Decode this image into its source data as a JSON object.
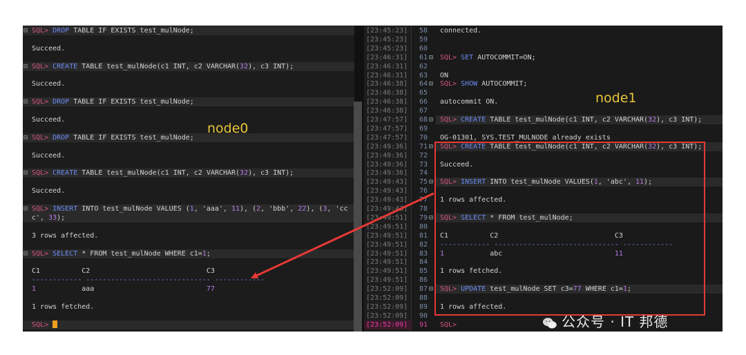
{
  "left": {
    "label": "node0",
    "lines": [
      {
        "fold": "⊟",
        "parts": [
          [
            "pr",
            "SQL> "
          ],
          [
            "kw",
            "DROP"
          ],
          [
            "txt",
            " TABLE IF EXISTS test_mulNode;"
          ]
        ],
        "hl": true
      },
      {
        "parts": [
          [
            "txt",
            ""
          ]
        ]
      },
      {
        "parts": [
          [
            "txt",
            "Succeed."
          ]
        ]
      },
      {
        "parts": [
          [
            "txt",
            ""
          ]
        ]
      },
      {
        "fold": "⊟",
        "parts": [
          [
            "pr",
            "SQL> "
          ],
          [
            "kw",
            "CREATE"
          ],
          [
            "txt",
            " TABLE test_mulNode(c1 INT, c2 VARCHAR("
          ],
          [
            "num",
            "32"
          ],
          [
            "txt",
            "), c3 INT);"
          ]
        ],
        "hl": true
      },
      {
        "parts": [
          [
            "txt",
            ""
          ]
        ]
      },
      {
        "parts": [
          [
            "txt",
            "Succeed."
          ]
        ]
      },
      {
        "parts": [
          [
            "txt",
            ""
          ]
        ]
      },
      {
        "fold": "⊟",
        "parts": [
          [
            "pr",
            "SQL> "
          ],
          [
            "kw",
            "DROP"
          ],
          [
            "txt",
            " TABLE IF EXISTS test_mulNode;"
          ]
        ],
        "hl": true
      },
      {
        "parts": [
          [
            "txt",
            ""
          ]
        ]
      },
      {
        "parts": [
          [
            "txt",
            "Succeed."
          ]
        ]
      },
      {
        "parts": [
          [
            "txt",
            ""
          ]
        ]
      },
      {
        "fold": "⊟",
        "parts": [
          [
            "pr",
            "SQL> "
          ],
          [
            "kw",
            "DROP"
          ],
          [
            "txt",
            " TABLE IF EXISTS test_mulNode;"
          ]
        ],
        "hl": true
      },
      {
        "parts": [
          [
            "txt",
            ""
          ]
        ]
      },
      {
        "parts": [
          [
            "txt",
            "Succeed."
          ]
        ]
      },
      {
        "parts": [
          [
            "txt",
            ""
          ]
        ]
      },
      {
        "fold": "⊟",
        "parts": [
          [
            "pr",
            "SQL> "
          ],
          [
            "kw",
            "CREATE"
          ],
          [
            "txt",
            " TABLE test_mulNode(c1 INT, c2 VARCHAR("
          ],
          [
            "num",
            "32"
          ],
          [
            "txt",
            "), c3 INT);"
          ]
        ],
        "hl": true
      },
      {
        "parts": [
          [
            "txt",
            ""
          ]
        ]
      },
      {
        "parts": [
          [
            "txt",
            "Succeed."
          ]
        ]
      },
      {
        "parts": [
          [
            "txt",
            ""
          ]
        ]
      },
      {
        "fold": "⊟",
        "parts": [
          [
            "pr",
            "SQL> "
          ],
          [
            "kw",
            "INSERT"
          ],
          [
            "txt",
            " INTO test_mulNode VALUES ("
          ],
          [
            "num",
            "1"
          ],
          [
            "txt",
            ", 'aaa', "
          ],
          [
            "num",
            "11"
          ],
          [
            "txt",
            "), ("
          ],
          [
            "num",
            "2"
          ],
          [
            "txt",
            ", 'bbb', "
          ],
          [
            "num",
            "22"
          ],
          [
            "txt",
            "), ("
          ],
          [
            "num",
            "3"
          ],
          [
            "txt",
            ", 'cc"
          ]
        ],
        "hl": true
      },
      {
        "parts": [
          [
            "txt",
            "c', "
          ],
          [
            "num",
            "33"
          ],
          [
            "txt",
            ");"
          ]
        ],
        "hl": true
      },
      {
        "parts": [
          [
            "txt",
            ""
          ]
        ]
      },
      {
        "parts": [
          [
            "txt",
            "3 rows affected."
          ]
        ]
      },
      {
        "parts": [
          [
            "txt",
            ""
          ]
        ]
      },
      {
        "fold": "⊟",
        "parts": [
          [
            "pr",
            "SQL> "
          ],
          [
            "kw",
            "SELECT"
          ],
          [
            "txt",
            " * FROM test_mulNode WHERE c1="
          ],
          [
            "num",
            "1"
          ],
          [
            "txt",
            ";"
          ]
        ],
        "hl": true
      },
      {
        "parts": [
          [
            "txt",
            ""
          ]
        ]
      },
      {
        "parts": [
          [
            "txt",
            "C1          C2                            C3"
          ]
        ]
      },
      {
        "parts": [
          [
            "kw",
            "------------ ------------------------------ ------------"
          ]
        ]
      },
      {
        "parts": [
          [
            "num",
            "1"
          ],
          [
            "txt",
            "           aaa                           "
          ],
          [
            "num",
            "77"
          ]
        ]
      },
      {
        "parts": [
          [
            "txt",
            ""
          ]
        ]
      },
      {
        "parts": [
          [
            "txt",
            "1 rows fetched."
          ]
        ]
      },
      {
        "parts": [
          [
            "txt",
            ""
          ]
        ]
      },
      {
        "parts": [
          [
            "pr",
            "SQL> "
          ]
        ],
        "cursor": true,
        "hl": true
      }
    ]
  },
  "right": {
    "label": "node1",
    "lines": [
      {
        "ts": "[23:45:23]",
        "ln": "58",
        "parts": [
          [
            "txt",
            "connected."
          ]
        ]
      },
      {
        "ts": "[23:45:23]",
        "ln": "59",
        "parts": [
          [
            "txt",
            ""
          ]
        ]
      },
      {
        "ts": "[23:45:23]",
        "ln": "60",
        "parts": [
          [
            "txt",
            ""
          ]
        ]
      },
      {
        "ts": "[23:46:31]",
        "ln": "61",
        "fold": "⊟",
        "parts": [
          [
            "pr",
            "SQL> "
          ],
          [
            "kw",
            "SET"
          ],
          [
            "txt",
            " AUTOCOMMIT=ON;"
          ]
        ]
      },
      {
        "ts": "[23:46:31]",
        "ln": "62",
        "parts": [
          [
            "txt",
            ""
          ]
        ]
      },
      {
        "ts": "[23:46:31]",
        "ln": "63",
        "parts": [
          [
            "txt",
            "ON"
          ]
        ]
      },
      {
        "ts": "[23:46:38]",
        "ln": "64",
        "fold": "⊟",
        "parts": [
          [
            "pr",
            "SQL> "
          ],
          [
            "kw",
            "SHOW"
          ],
          [
            "txt",
            " AUTOCOMMIT;"
          ]
        ]
      },
      {
        "ts": "[23:46:38]",
        "ln": "65",
        "parts": [
          [
            "txt",
            ""
          ]
        ]
      },
      {
        "ts": "[23:46:38]",
        "ln": "66",
        "parts": [
          [
            "txt",
            "autocommit ON."
          ]
        ]
      },
      {
        "ts": "[23:46:38]",
        "ln": "67",
        "parts": [
          [
            "txt",
            ""
          ]
        ]
      },
      {
        "ts": "[23:47:57]",
        "ln": "68",
        "fold": "⊟",
        "parts": [
          [
            "pr",
            "SQL> "
          ],
          [
            "kw",
            "CREATE"
          ],
          [
            "txt",
            " TABLE test_mulNode(c1 INT, c2 VARCHAR("
          ],
          [
            "num",
            "32"
          ],
          [
            "txt",
            "), c3 INT);"
          ]
        ],
        "hl": true
      },
      {
        "ts": "[23:47:57]",
        "ln": "69",
        "parts": [
          [
            "txt",
            ""
          ]
        ]
      },
      {
        "ts": "[23:47:57]",
        "ln": "70",
        "parts": [
          [
            "txt",
            "OG-01301, SYS.TEST_MULNODE already exists"
          ]
        ]
      },
      {
        "ts": "[23:49:36]",
        "ln": "71",
        "fold": "⊟",
        "parts": [
          [
            "pr",
            "SQL> "
          ],
          [
            "kw",
            "CREATE"
          ],
          [
            "txt",
            " TABLE test_mulNode(c1 INT, c2 VARCHAR("
          ],
          [
            "num",
            "32"
          ],
          [
            "txt",
            "), c3 INT);"
          ]
        ],
        "hl": true
      },
      {
        "ts": "[23:49:36]",
        "ln": "72",
        "parts": [
          [
            "txt",
            ""
          ]
        ]
      },
      {
        "ts": "[23:49:36]",
        "ln": "73",
        "parts": [
          [
            "txt",
            "Succeed."
          ]
        ]
      },
      {
        "ts": "[23:49:36]",
        "ln": "74",
        "parts": [
          [
            "txt",
            ""
          ]
        ]
      },
      {
        "ts": "[23:49:43]",
        "ln": "75",
        "fold": "⊟",
        "parts": [
          [
            "pr",
            "SQL> "
          ],
          [
            "kw",
            "INSERT"
          ],
          [
            "txt",
            " INTO test_mulNode VALUES("
          ],
          [
            "num",
            "1"
          ],
          [
            "txt",
            ", 'abc', "
          ],
          [
            "num",
            "11"
          ],
          [
            "txt",
            ");"
          ]
        ],
        "hl": true
      },
      {
        "ts": "[23:49:43]",
        "ln": "76",
        "parts": [
          [
            "txt",
            ""
          ]
        ]
      },
      {
        "ts": "[23:49:43]",
        "ln": "77",
        "parts": [
          [
            "txt",
            "1 rows affected."
          ]
        ]
      },
      {
        "ts": "[23:49:43]",
        "ln": "78",
        "parts": [
          [
            "txt",
            ""
          ]
        ]
      },
      {
        "ts": "[23:49:51]",
        "ln": "79",
        "fold": "⊟",
        "parts": [
          [
            "pr",
            "SQL> "
          ],
          [
            "kw",
            "SELECT"
          ],
          [
            "txt",
            " * FROM test_mulNode;"
          ]
        ],
        "hl": true
      },
      {
        "ts": "[23:49:51]",
        "ln": "80",
        "parts": [
          [
            "txt",
            ""
          ]
        ]
      },
      {
        "ts": "[23:49:51]",
        "ln": "81",
        "parts": [
          [
            "txt",
            "C1          C2                            C3"
          ]
        ]
      },
      {
        "ts": "[23:49:51]",
        "ln": "82",
        "parts": [
          [
            "kw",
            "------------ ------------------------------ ------------"
          ]
        ]
      },
      {
        "ts": "[23:49:51]",
        "ln": "83",
        "parts": [
          [
            "num",
            "1"
          ],
          [
            "txt",
            "           abc                           "
          ],
          [
            "num",
            "11"
          ]
        ]
      },
      {
        "ts": "[23:49:51]",
        "ln": "84",
        "parts": [
          [
            "txt",
            ""
          ]
        ]
      },
      {
        "ts": "[23:49:51]",
        "ln": "85",
        "parts": [
          [
            "txt",
            "1 rows fetched."
          ]
        ]
      },
      {
        "ts": "[23:49:51]",
        "ln": "86",
        "parts": [
          [
            "txt",
            ""
          ]
        ]
      },
      {
        "ts": "[23:52:09]",
        "ln": "87",
        "fold": "⊟",
        "parts": [
          [
            "pr",
            "SQL> "
          ],
          [
            "kw",
            "UPDATE"
          ],
          [
            "txt",
            " test_mulNode SET c3="
          ],
          [
            "num",
            "77"
          ],
          [
            "txt",
            " WHERE c1="
          ],
          [
            "num",
            "1"
          ],
          [
            "txt",
            ";"
          ]
        ],
        "hl": true
      },
      {
        "ts": "[23:52:09]",
        "ln": "88",
        "parts": [
          [
            "txt",
            ""
          ]
        ]
      },
      {
        "ts": "[23:52:09]",
        "ln": "89",
        "parts": [
          [
            "txt",
            "1 rows affected."
          ]
        ]
      },
      {
        "ts": "[23:52:09]",
        "ln": "90",
        "parts": [
          [
            "txt",
            ""
          ]
        ]
      },
      {
        "ts": "[23:52:09]",
        "ln": "91",
        "pink": true,
        "parts": [
          [
            "pr",
            "SQL> "
          ]
        ]
      }
    ]
  },
  "watermark": "公众号 · IT 邦德",
  "colors": {
    "keyword": "#6c8cf5",
    "prompt": "#d6557a",
    "number": "#b77be8",
    "annotation": "#e53935",
    "label": "#e8c53a"
  }
}
